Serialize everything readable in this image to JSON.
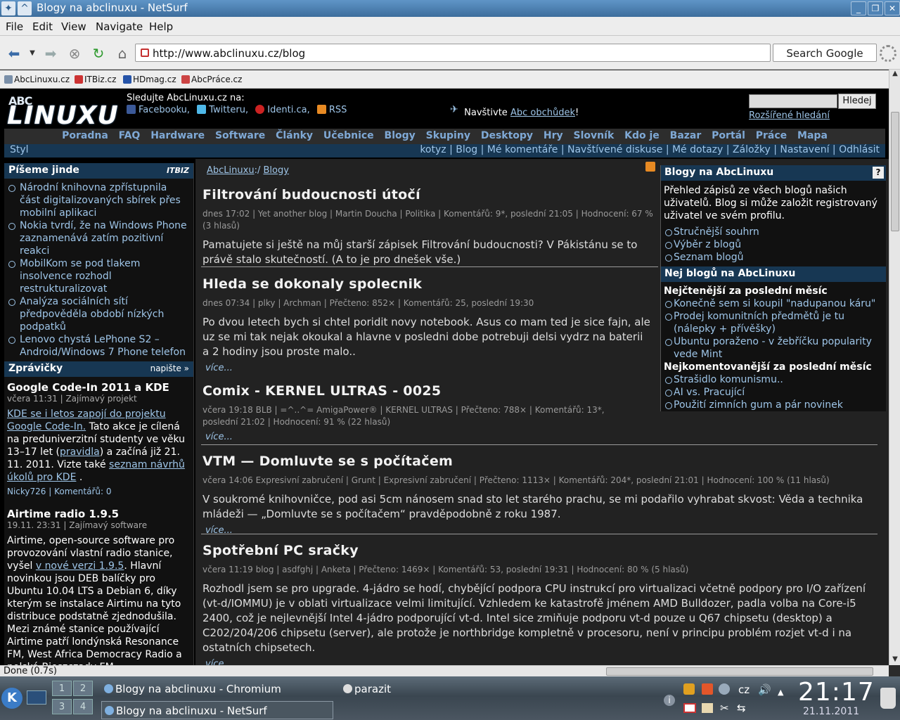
{
  "window": {
    "title": "Blogy na abclinuxu - NetSurf"
  },
  "menu": [
    "File",
    "Edit",
    "View",
    "Navigate",
    "Help"
  ],
  "toolbar": {
    "url": "http://www.abclinuxu.cz/blog",
    "search_placeholder": "Search Google"
  },
  "bookmarks": [
    "AbcLinuxu.cz",
    "ITBiz.cz",
    "HDmag.cz",
    "AbcPráce.cz"
  ],
  "header": {
    "logo_top": "ABC",
    "logo_main": "LINUXU",
    "follow_label": "Sledujte AbcLinuxu.cz na:",
    "follow": [
      "Facebooku,",
      "Twitteru,",
      "Identi.ca,",
      "RSS"
    ],
    "visit_prefix": "Navštivte",
    "visit_link": "Abc obchůdek",
    "visit_suffix": "!",
    "search_button": "Hledej",
    "advanced_search": "Rozšířené hledání"
  },
  "nav": [
    "Poradna",
    "FAQ",
    "Hardware",
    "Software",
    "Články",
    "Učebnice",
    "Blogy",
    "Skupiny",
    "Desktopy",
    "Hry",
    "Slovník",
    "Kdo je",
    "Bazar",
    "Portál",
    "Práce",
    "Mapa"
  ],
  "userbar": {
    "style": "Styl",
    "links": "kotyz | Blog | Mé komentáře | Navštívené diskuse | Mé dotazy | Záložky | Nastavení | Odhlásit"
  },
  "left": {
    "box1_title": "Píšeme jinde",
    "box1_badge": "ITBIZ",
    "box1_items": [
      "Národní knihovna zpřístupnila část digitalizovaných sbírek přes mobilní aplikaci",
      "Nokia tvrdí, že na Windows Phone zaznamenává zatím pozitivní reakci",
      "MobilKom se pod tlakem insolvence rozhodl restrukturalizovat",
      "Analýza sociálních sítí předpověděla období nízkých podpatků",
      "Lenovo chystá LePhone S2 – Android/Windows 7 Phone telefon"
    ],
    "box2_title": "Zprávičky",
    "box2_more": "napište »",
    "news": [
      {
        "title": "Google Code-In 2011 a KDE",
        "meta": "včera 11:31 | Zajímavý projekt",
        "p1": "KDE se i letos zapojí do projektu Google Code-In.",
        "p2": " Tato akce je cílená na preduniverzitní studenty ve věku 13–17 let (",
        "p3": "pravidla",
        "p4": ") a začíná již 21. 11. 2011. Vizte také ",
        "p5": "seznam návrhů úkolů pro KDE",
        "p6": " .",
        "by": "Nicky726 | Komentářů: 0"
      },
      {
        "title": "Airtime radio 1.9.5",
        "meta": "19.11. 23:31 | Zajímavý software",
        "p1": "Airtime, open-source software pro provozování vlastní radio stanice, vyšel ",
        "p2": "v nové verzi 1.9.5",
        "p3": ". Hlavní novinkou jsou DEB balíčky pro Ubuntu 10.04 LTS a Debian 6, díky kterým se instalace Airtimu na tyto distribuce podstatně zjednodušila. Mezi známé stanice používající Airtime patří londýnská Resonance FM, West Africa Democracy Radio a polská Bieszczady FM."
      }
    ]
  },
  "center": {
    "crumb_home": "AbcLinuxu",
    "crumb_sep": ":/ ",
    "crumb_current": "Blogy",
    "more_label": "více...",
    "posts": [
      {
        "title": "Filtrování budoucnosti útočí",
        "meta": "dnes 17:02 | Yet another blog | Martin Doucha | Politika | Komentářů: 9*, poslední 21:05 | Hodnocení: 67 % (3 hlasů)",
        "text": "Pamatujete si ještě na můj starší zápisek Filtrování budoucnosti? V Pákistánu se to právě stalo skutečností. (A to je pro dnešek vše.)"
      },
      {
        "title": "Hleda se dokonaly spolecnik",
        "meta": "dnes 07:34 | plky | Archman | Přečteno: 852× | Komentářů: 25, poslední 19:30",
        "text": "Po dvou letech bych si chtel poridit novy notebook. Asus co mam ted je sice fajn, ale uz se mi tak nejak okoukal a hlavne v posledni dobe potrebuji delsi vydrz na baterii a 2 hodiny jsou proste malo.."
      },
      {
        "title": "Comix - KERNEL ULTRAS - 0025",
        "meta": "včera 19:18 BLB | =^..^= AmigaPower® | KERNEL ULTRAS | Přečteno: 788× | Komentářů: 13*, poslední 21:02 | Hodnocení: 91 % (22 hlasů)",
        "text": ""
      },
      {
        "title": "VTM — Domluvte se s počítačem",
        "meta": "včera 14:06 Expresivní zabručení | Grunt | Expresivní zabručení | Přečteno: 1113× | Komentářů: 204*, poslední 21:01 | Hodnocení: 100 % (11 hlasů)",
        "text": "V soukromé knihovničce, pod asi 5cm nánosem snad sto let starého prachu, se mi podařilo vyhrabat skvost: Věda a technika mládeži — „Domluvte se s počítačem“ pravděpodobně z roku 1987."
      },
      {
        "title": "Spotřební PC sračky",
        "meta": "včera 11:19 blog | asdfghj | Anketa | Přečteno: 1469× | Komentářů: 53, poslední 19:31 | Hodnocení: 80 % (5 hlasů)",
        "text": "Rozhodl jsem se pro upgrade. 4-jádro se hodí, chybějící podpora CPU instrukcí pro virtualizaci včetně podpory pro I/O zařízení (vt-d/IOMMU) je v oblati virtualizace velmi limitující. Vzhledem ke katastrofě jménem AMD Bulldozer, padla volba na Core-i5 2400, což je nejlevnější Intel 4-jádro podporující vt-d. Intel sice zmiňuje podporu vt-d pouze u Q67 chipsetu (desktop) a C202/204/206 chipsetu (server), ale protože je northbridge kompletně v procesoru, není v principu problém rozjet vt-d i na ostatních chipsetech."
      }
    ]
  },
  "right": {
    "title": "Blogy na AbcLinuxu",
    "help": "?",
    "desc": "Přehled zápisů ze všech blogů našich uživatelů. Blog si může založit registrovaný uživatel ve svém profilu.",
    "links": [
      "Stručnější souhrn",
      "Výběr z blogů",
      "Seznam blogů"
    ],
    "top_title": "Nej blogů na AbcLinuxu",
    "read_title": "Nejčtenější za poslední měsíc",
    "read": [
      "Konečně sem si koupil \"nadupanou káru\"",
      "Prodej komunitních předmětů je tu (nálepky + přívěšky)",
      "Ubuntu poraženo - v žebříčku popularity vede Mint"
    ],
    "comm_title": "Nejkomentovanější za poslední měsíc",
    "comm": [
      "Strašidlo komunismu..",
      "AI vs. Pracující",
      "Použití zimních gum a pár novinek"
    ]
  },
  "status": "Done (0.7s)",
  "taskbar": {
    "pager": [
      "1",
      "2",
      "3",
      "4"
    ],
    "tasks": [
      "Blogy na abclinuxu - Chromium",
      "parazit",
      "Blogy na abclinuxu - NetSurf"
    ],
    "lang": "cz",
    "time": "21:17",
    "date": "21.11.2011"
  },
  "colors": {
    "accent": "#173753",
    "link": "#9ec5e8",
    "nav": "#7fa9d6"
  }
}
